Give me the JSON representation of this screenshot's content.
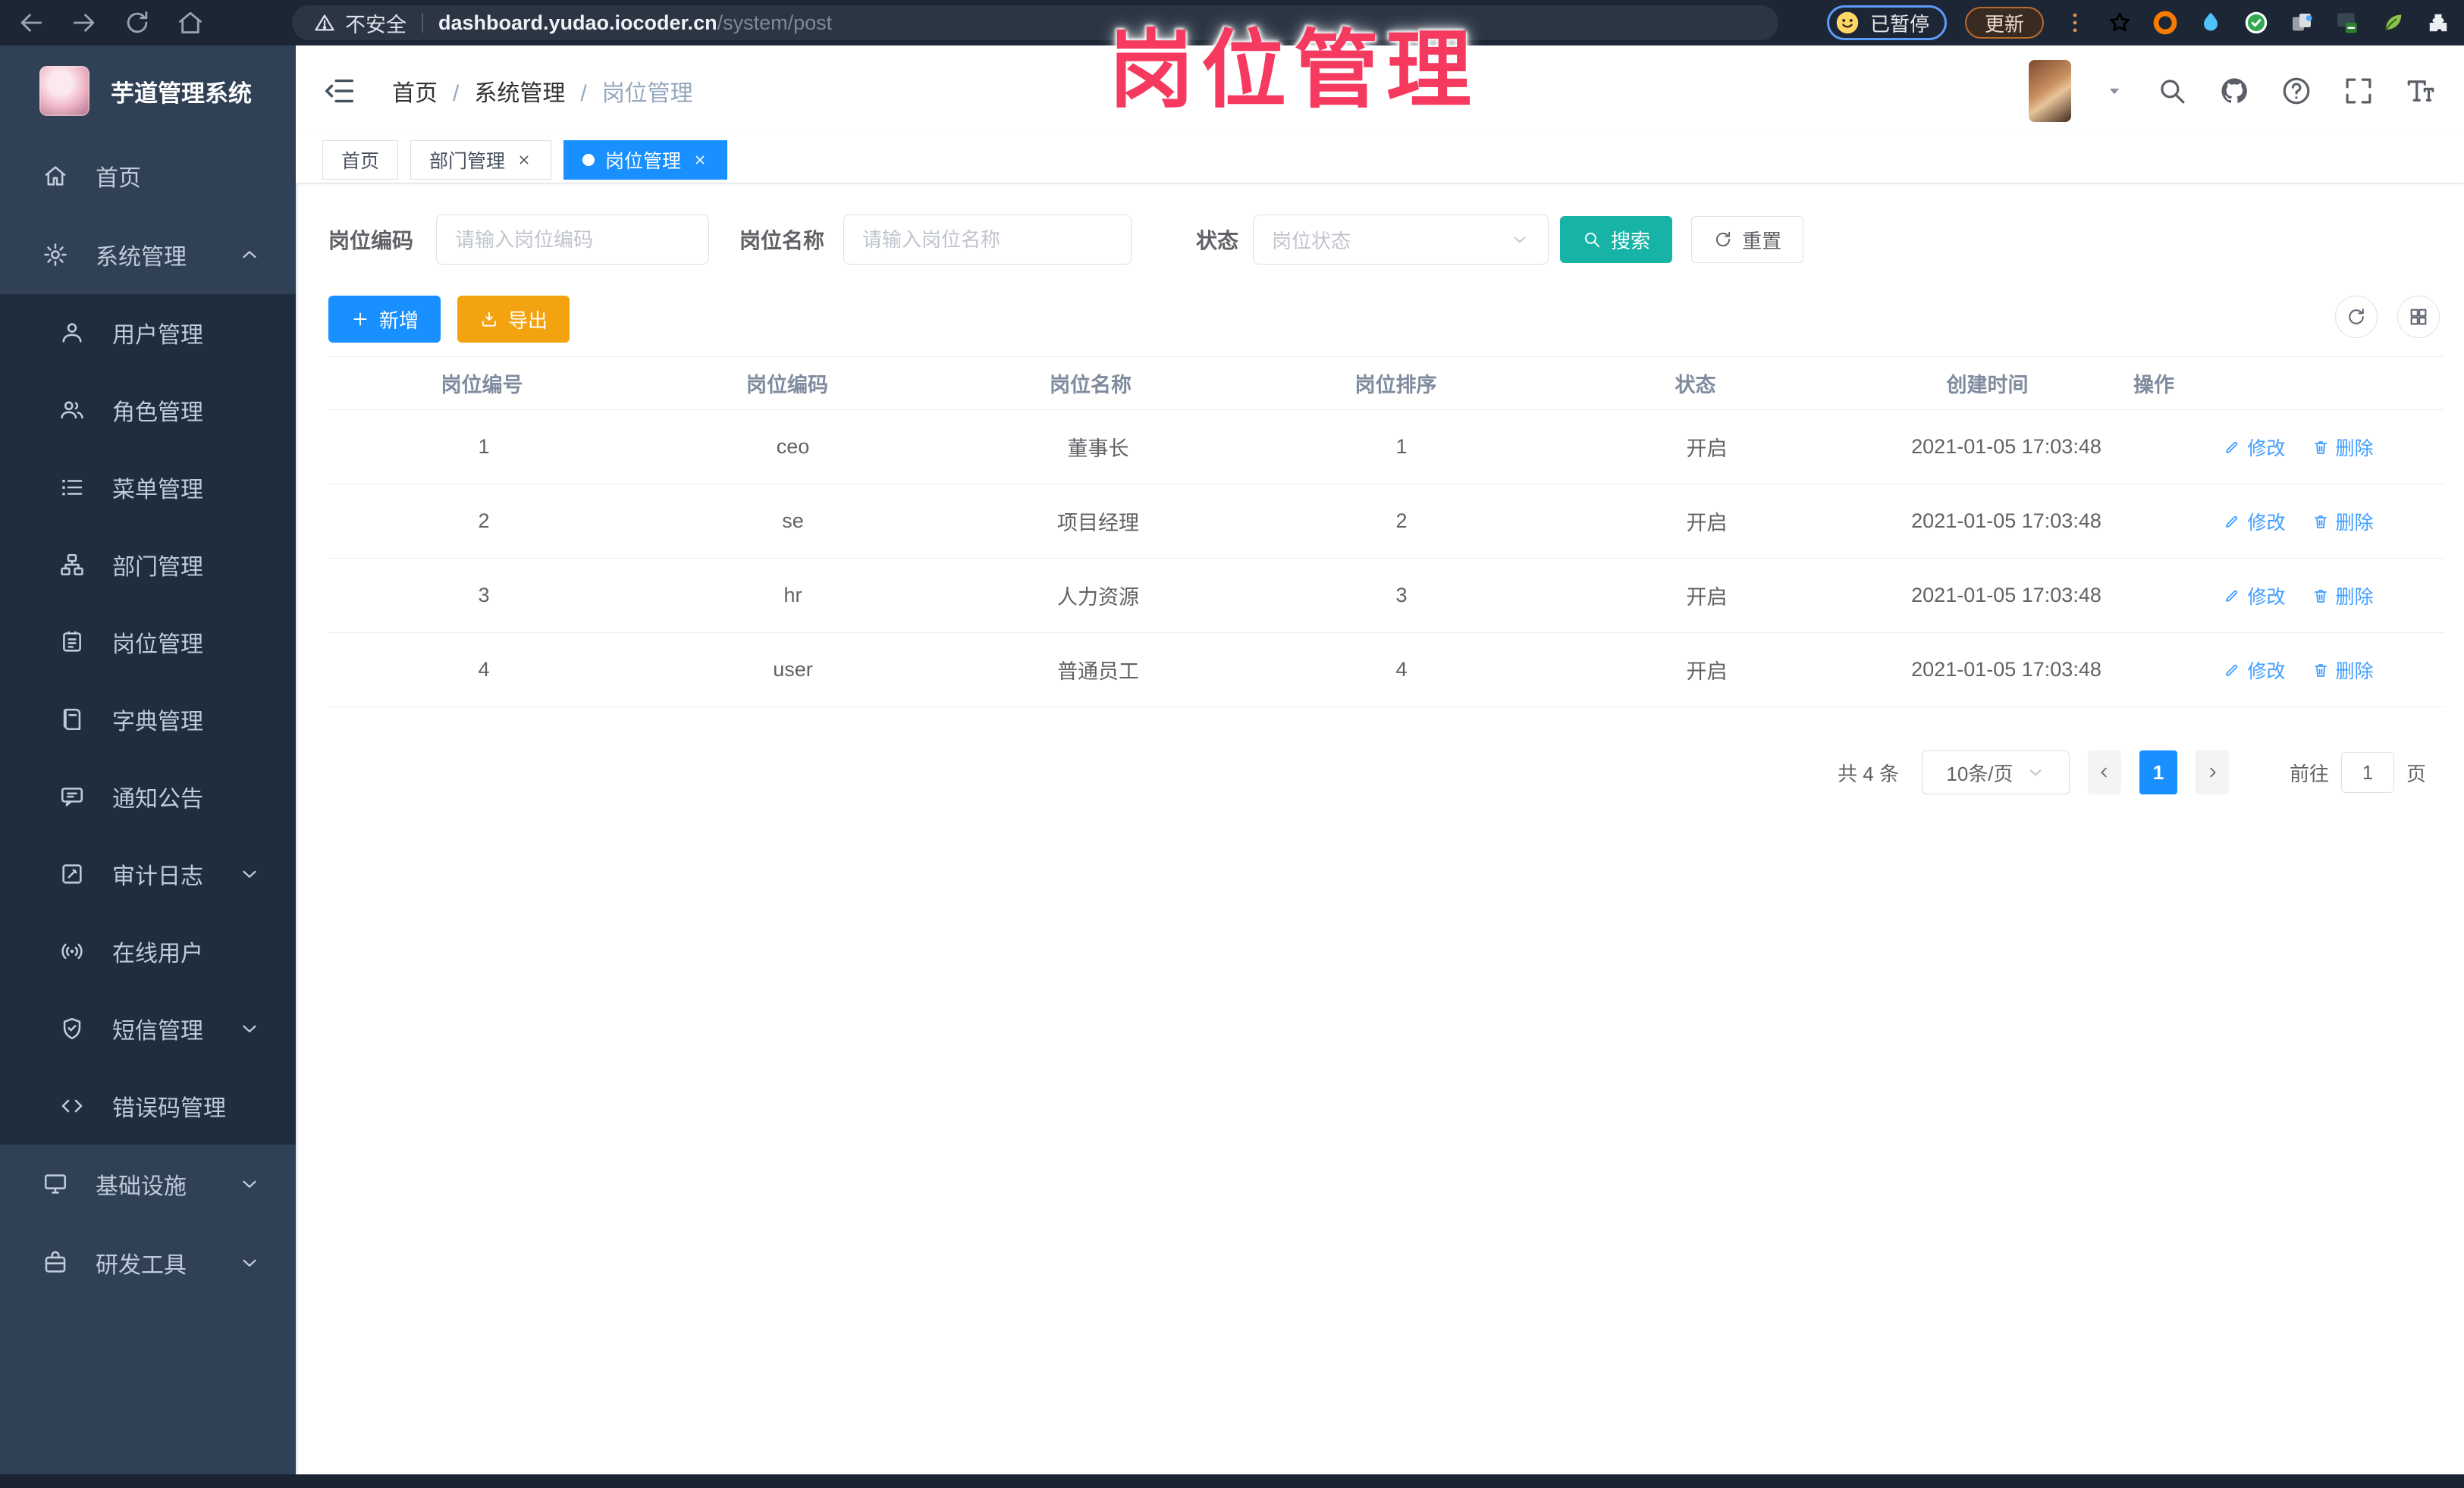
{
  "browser": {
    "security_label": "不安全",
    "url_host": "dashboard.yudao.iocoder.cn",
    "url_path": "/system/post",
    "profile_status": "已暂停",
    "update_label": "更新",
    "nav_icons": [
      "back-arrow-icon",
      "forward-arrow-icon",
      "reload-icon",
      "browser-home-icon"
    ],
    "extension_icons": [
      "bookmark-star-icon",
      "extension-ring-icon",
      "extension-drop-icon",
      "extension-check-icon",
      "extension-tabs-icon",
      "extension-chat-icon",
      "extension-leaf-icon",
      "extension-puzzle-icon"
    ]
  },
  "overlay_title": "岗位管理",
  "sidebar": {
    "app_title": "芋道管理系统",
    "items": [
      {
        "label": "首页",
        "icon": "home-icon"
      },
      {
        "label": "系统管理",
        "icon": "gear-icon",
        "chevron_icon": "chevron-up-icon"
      },
      {
        "label": "用户管理",
        "icon": "user-icon",
        "sub": true
      },
      {
        "label": "角色管理",
        "icon": "roles-icon",
        "sub": true
      },
      {
        "label": "菜单管理",
        "icon": "menu-list-icon",
        "sub": true
      },
      {
        "label": "部门管理",
        "icon": "org-tree-icon",
        "sub": true
      },
      {
        "label": "岗位管理",
        "icon": "post-badge-icon",
        "sub": true,
        "active": true
      },
      {
        "label": "字典管理",
        "icon": "dictionary-icon",
        "sub": true
      },
      {
        "label": "通知公告",
        "icon": "announcement-icon",
        "sub": true
      },
      {
        "label": "审计日志",
        "icon": "audit-log-icon",
        "sub": true,
        "chevron_icon": "chevron-down-icon"
      },
      {
        "label": "在线用户",
        "icon": "online-users-icon",
        "sub": true
      },
      {
        "label": "短信管理",
        "icon": "sms-shield-icon",
        "sub": true,
        "chevron_icon": "chevron-down-icon"
      },
      {
        "label": "错误码管理",
        "icon": "error-code-icon",
        "sub": true
      },
      {
        "label": "基础设施",
        "icon": "infrastructure-icon",
        "chevron_icon": "chevron-down-icon"
      },
      {
        "label": "研发工具",
        "icon": "dev-tools-icon",
        "chevron_icon": "chevron-down-icon"
      }
    ]
  },
  "header": {
    "breadcrumb": [
      {
        "label": "首页"
      },
      {
        "label": "系统管理"
      },
      {
        "label": "岗位管理"
      }
    ],
    "action_icons": [
      "search-icon",
      "github-icon",
      "help-icon",
      "fullscreen-icon",
      "font-size-icon"
    ]
  },
  "tabs": [
    {
      "label": "首页"
    },
    {
      "label": "部门管理",
      "closable": true
    },
    {
      "label": "岗位管理",
      "closable": true,
      "active": true
    }
  ],
  "filters": {
    "post_code_label": "岗位编码",
    "post_code_placeholder": "请输入岗位编码",
    "post_name_label": "岗位名称",
    "post_name_placeholder": "请输入岗位名称",
    "status_label": "状态",
    "status_placeholder": "岗位状态",
    "search_label": "搜索",
    "reset_label": "重置"
  },
  "toolbar": {
    "add_label": "新增",
    "export_label": "导出"
  },
  "table": {
    "columns": [
      {
        "label": "岗位编号"
      },
      {
        "label": "岗位编码"
      },
      {
        "label": "岗位名称"
      },
      {
        "label": "岗位排序"
      },
      {
        "label": "状态"
      },
      {
        "label": "创建时间"
      },
      {
        "label": "操作"
      }
    ],
    "rows": [
      {
        "id": "1",
        "code": "ceo",
        "name": "董事长",
        "sort": "1",
        "status": "开启",
        "created": "2021-01-05 17:03:48"
      },
      {
        "id": "2",
        "code": "se",
        "name": "项目经理",
        "sort": "2",
        "status": "开启",
        "created": "2021-01-05 17:03:48"
      },
      {
        "id": "3",
        "code": "hr",
        "name": "人力资源",
        "sort": "3",
        "status": "开启",
        "created": "2021-01-05 17:03:48"
      },
      {
        "id": "4",
        "code": "user",
        "name": "普通员工",
        "sort": "4",
        "status": "开启",
        "created": "2021-01-05 17:03:48"
      }
    ],
    "edit_label": "修改",
    "delete_label": "删除"
  },
  "pagination": {
    "total_label": "共 4 条",
    "page_size_label": "10条/页",
    "current_page": "1",
    "goto_label": "前往",
    "goto_value": "1",
    "unit_label": "页"
  },
  "colors": {
    "primary_blue": "#1890ff",
    "menu_active_blue": "#409eff",
    "search_teal": "#17b3a6",
    "export_orange": "#f2a30f",
    "overlay_pink": "#f5395f",
    "sidebar_bg": "#304156",
    "submenu_bg": "#1f2d3d",
    "browser_bar_bg": "#1d2634"
  }
}
